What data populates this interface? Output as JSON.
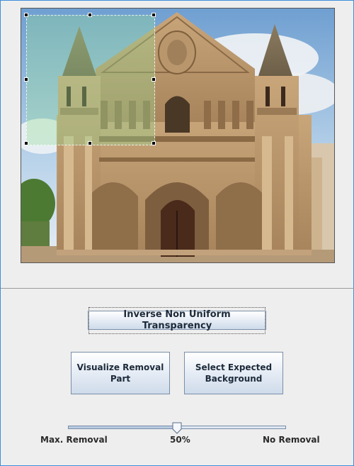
{
  "window": {
    "border_color": "#3c8fd8",
    "background": "#eeeeee"
  },
  "image": {
    "subject": "church-facade-photo",
    "sky_color": "#8fb6dc",
    "stone_color": "#c9a57a",
    "selection_overlay_color": "#96dc96"
  },
  "buttons": {
    "inverse_label": "Inverse Non Uniform Transparency",
    "visualize_line1": "Visualize Removal",
    "visualize_line2": "Part",
    "select_line1": "Select Expected",
    "select_line2": "Background"
  },
  "slider": {
    "min_label": "Max. Removal",
    "value_label": "50%",
    "max_label": "No Removal",
    "value_fraction": 0.5
  }
}
